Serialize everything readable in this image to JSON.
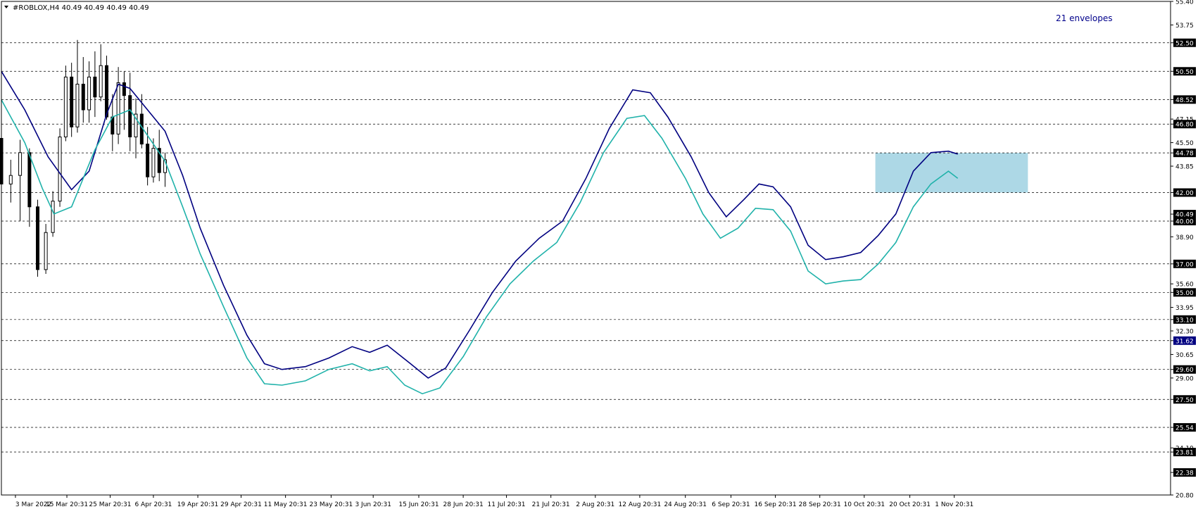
{
  "header": {
    "symbol_line": "#ROBLOX,H4  40.49 40.49 40.49 40.49",
    "indicator_label": "21 envelopes"
  },
  "colors": {
    "background": "#ffffff",
    "candle": "#000000",
    "grid": "#000000",
    "envelope_upper": "#000080",
    "envelope_lower": "#20b2aa",
    "zone_fill": "#add8e6",
    "label_highlight": "#000000",
    "label_highlight_text": "#ffffff",
    "current_price_bg": "#000080"
  },
  "chart_data": {
    "type": "candlestick",
    "title": "",
    "ylim": [
      20.8,
      55.4
    ],
    "y_tick_labels": [
      "55.40",
      "53.75",
      "52.50",
      "50.50",
      "48.52",
      "47.15",
      "46.80",
      "45.50",
      "44.78",
      "43.85",
      "42.00",
      "40.49",
      "40.00",
      "38.90",
      "37.00",
      "35.60",
      "35.00",
      "33.95",
      "33.10",
      "32.30",
      "31.62",
      "30.65",
      "29.60",
      "29.00",
      "27.50",
      "25.54",
      "24.10",
      "23.81",
      "22.38",
      "20.80"
    ],
    "highlighted_levels": [
      "52.50",
      "50.50",
      "48.52",
      "46.80",
      "44.78",
      "42.00",
      "40.49",
      "40.00",
      "37.00",
      "35.00",
      "33.10",
      "29.60",
      "27.50",
      "25.54",
      "23.81",
      "22.38"
    ],
    "current_price_label": "31.62",
    "dashed_levels": [
      52.5,
      50.5,
      48.52,
      46.8,
      44.78,
      42.0,
      40.0,
      37.0,
      35.0,
      33.1,
      31.62,
      29.6,
      27.5,
      25.54,
      23.81
    ],
    "x_tick_labels": [
      "3 Mar 2022",
      "15 Mar 20:31",
      "25 Mar 20:31",
      "6 Apr 20:31",
      "19 Apr 20:31",
      "29 Apr 20:31",
      "11 May 20:31",
      "23 May 20:31",
      "3 Jun 20:31",
      "15 Jun 20:31",
      "28 Jun 20:31",
      "11 Jul 20:31",
      "21 Jul 20:31",
      "2 Aug 20:31",
      "12 Aug 20:31",
      "24 Aug 20:31",
      "6 Sep 20:31",
      "16 Sep 20:31",
      "28 Sep 20:31",
      "10 Oct 20:31",
      "20 Oct 20:31",
      "1 Nov 20:31"
    ],
    "x_tick_positions": [
      0.012,
      0.056,
      0.093,
      0.13,
      0.168,
      0.205,
      0.243,
      0.282,
      0.318,
      0.357,
      0.395,
      0.432,
      0.47,
      0.508,
      0.546,
      0.585,
      0.624,
      0.662,
      0.7,
      0.738,
      0.777,
      0.815
    ],
    "zone": {
      "x_start": 0.7475,
      "x_end": 0.878,
      "y_low": 42.0,
      "y_high": 44.78
    },
    "series": [
      {
        "name": "upper",
        "values": [
          [
            0.0,
            50.5
          ],
          [
            0.02,
            47.8
          ],
          [
            0.04,
            44.5
          ],
          [
            0.06,
            42.2
          ],
          [
            0.075,
            43.5
          ],
          [
            0.09,
            47.5
          ],
          [
            0.1,
            49.6
          ],
          [
            0.11,
            49.3
          ],
          [
            0.125,
            47.8
          ],
          [
            0.14,
            46.3
          ],
          [
            0.155,
            43.2
          ],
          [
            0.17,
            39.5
          ],
          [
            0.19,
            35.5
          ],
          [
            0.21,
            32.0
          ],
          [
            0.225,
            30.0
          ],
          [
            0.24,
            29.6
          ],
          [
            0.26,
            29.8
          ],
          [
            0.28,
            30.4
          ],
          [
            0.3,
            31.2
          ],
          [
            0.315,
            30.8
          ],
          [
            0.33,
            31.3
          ],
          [
            0.35,
            30.0
          ],
          [
            0.365,
            29.0
          ],
          [
            0.38,
            29.7
          ],
          [
            0.4,
            32.3
          ],
          [
            0.42,
            35.0
          ],
          [
            0.44,
            37.2
          ],
          [
            0.46,
            38.8
          ],
          [
            0.48,
            40.0
          ],
          [
            0.5,
            43.0
          ],
          [
            0.52,
            46.5
          ],
          [
            0.54,
            49.2
          ],
          [
            0.555,
            49.0
          ],
          [
            0.57,
            47.3
          ],
          [
            0.59,
            44.5
          ],
          [
            0.605,
            42.0
          ],
          [
            0.62,
            40.3
          ],
          [
            0.635,
            41.5
          ],
          [
            0.648,
            42.6
          ],
          [
            0.66,
            42.4
          ],
          [
            0.675,
            41.0
          ],
          [
            0.69,
            38.3
          ],
          [
            0.705,
            37.3
          ],
          [
            0.72,
            37.5
          ],
          [
            0.735,
            37.8
          ],
          [
            0.75,
            39.0
          ],
          [
            0.765,
            40.5
          ],
          [
            0.78,
            43.5
          ],
          [
            0.795,
            44.8
          ],
          [
            0.81,
            44.9
          ],
          [
            0.818,
            44.7
          ]
        ]
      },
      {
        "name": "lower",
        "values": [
          [
            0.0,
            48.5
          ],
          [
            0.02,
            45.5
          ],
          [
            0.035,
            42.3
          ],
          [
            0.045,
            40.5
          ],
          [
            0.06,
            41.0
          ],
          [
            0.08,
            45.0
          ],
          [
            0.095,
            47.3
          ],
          [
            0.11,
            47.8
          ],
          [
            0.125,
            46.0
          ],
          [
            0.14,
            44.2
          ],
          [
            0.155,
            41.0
          ],
          [
            0.17,
            37.7
          ],
          [
            0.19,
            34.0
          ],
          [
            0.21,
            30.4
          ],
          [
            0.225,
            28.6
          ],
          [
            0.24,
            28.5
          ],
          [
            0.26,
            28.8
          ],
          [
            0.28,
            29.6
          ],
          [
            0.3,
            30.0
          ],
          [
            0.315,
            29.5
          ],
          [
            0.33,
            29.8
          ],
          [
            0.345,
            28.5
          ],
          [
            0.36,
            27.9
          ],
          [
            0.375,
            28.3
          ],
          [
            0.395,
            30.5
          ],
          [
            0.415,
            33.3
          ],
          [
            0.435,
            35.6
          ],
          [
            0.455,
            37.2
          ],
          [
            0.475,
            38.5
          ],
          [
            0.495,
            41.3
          ],
          [
            0.515,
            44.8
          ],
          [
            0.535,
            47.2
          ],
          [
            0.55,
            47.4
          ],
          [
            0.565,
            45.8
          ],
          [
            0.585,
            43.0
          ],
          [
            0.6,
            40.5
          ],
          [
            0.615,
            38.8
          ],
          [
            0.63,
            39.5
          ],
          [
            0.645,
            40.9
          ],
          [
            0.66,
            40.8
          ],
          [
            0.675,
            39.3
          ],
          [
            0.69,
            36.5
          ],
          [
            0.705,
            35.6
          ],
          [
            0.72,
            35.8
          ],
          [
            0.735,
            35.9
          ],
          [
            0.75,
            37.0
          ],
          [
            0.765,
            38.5
          ],
          [
            0.78,
            41.0
          ],
          [
            0.795,
            42.6
          ],
          [
            0.81,
            43.5
          ],
          [
            0.818,
            43.0
          ]
        ]
      }
    ],
    "candles": [
      [
        0.0,
        45.8,
        46.2,
        42.0,
        42.6
      ],
      [
        0.008,
        42.6,
        44.3,
        41.3,
        43.2
      ],
      [
        0.016,
        43.2,
        45.7,
        40.0,
        44.8
      ],
      [
        0.024,
        44.8,
        45.1,
        39.6,
        41.0
      ],
      [
        0.031,
        41.0,
        41.5,
        36.1,
        36.6
      ],
      [
        0.038,
        36.6,
        39.8,
        36.3,
        39.2
      ],
      [
        0.044,
        39.2,
        42.1,
        38.9,
        41.4
      ],
      [
        0.05,
        41.4,
        46.5,
        41.0,
        45.9
      ],
      [
        0.055,
        45.9,
        50.9,
        45.6,
        50.1
      ],
      [
        0.06,
        50.1,
        51.1,
        45.9,
        46.6
      ],
      [
        0.065,
        46.6,
        52.7,
        46.2,
        49.6
      ],
      [
        0.07,
        49.6,
        51.5,
        46.9,
        47.8
      ],
      [
        0.075,
        47.8,
        51.2,
        46.9,
        50.1
      ],
      [
        0.08,
        50.1,
        51.9,
        47.3,
        48.7
      ],
      [
        0.085,
        48.7,
        52.4,
        48.4,
        50.9
      ],
      [
        0.09,
        50.9,
        51.6,
        47.1,
        47.3
      ],
      [
        0.095,
        47.3,
        48.9,
        44.9,
        46.1
      ],
      [
        0.1,
        46.1,
        50.8,
        45.4,
        49.7
      ],
      [
        0.105,
        49.7,
        50.5,
        46.4,
        48.8
      ],
      [
        0.11,
        48.8,
        50.4,
        44.9,
        45.9
      ],
      [
        0.115,
        45.9,
        48.6,
        44.4,
        47.5
      ],
      [
        0.12,
        47.5,
        48.9,
        45.1,
        45.4
      ],
      [
        0.125,
        45.4,
        46.6,
        42.5,
        43.1
      ],
      [
        0.13,
        43.1,
        45.8,
        42.7,
        45.1
      ],
      [
        0.135,
        45.1,
        46.4,
        42.8,
        43.4
      ],
      [
        0.14,
        43.4,
        44.8,
        42.4,
        44.3
      ]
    ]
  }
}
